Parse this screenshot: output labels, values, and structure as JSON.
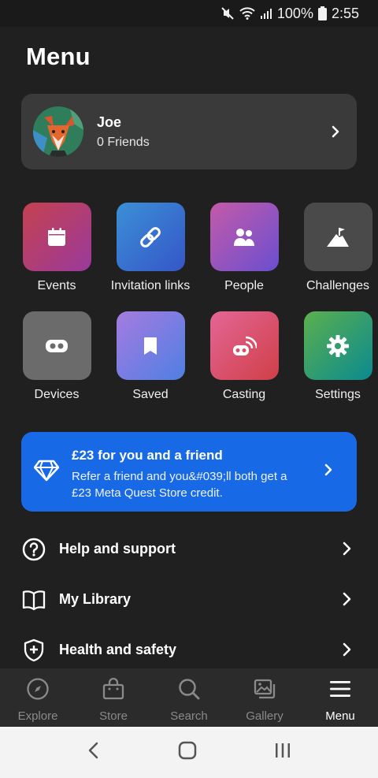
{
  "status_bar": {
    "battery": "100%",
    "time": "2:55",
    "icons": [
      "mute-icon",
      "wifi-icon",
      "signal-icon",
      "battery-icon"
    ]
  },
  "header": {
    "title": "Menu"
  },
  "profile": {
    "name": "Joe",
    "friends": "0 Friends"
  },
  "tiles": [
    {
      "label": "Events",
      "icon": "calendar-icon",
      "colors": [
        "#c5414f",
        "#9a3a9c"
      ]
    },
    {
      "label": "Invitation links",
      "icon": "link-icon",
      "colors": [
        "#3b8fd6",
        "#3556c8"
      ]
    },
    {
      "label": "People",
      "icon": "people-icon",
      "colors": [
        "#c45aa8",
        "#6a4fd0"
      ]
    },
    {
      "label": "Challenges",
      "icon": "mountain-flag-icon",
      "colors": [
        "#4a4a4a",
        "#4a4a4a"
      ]
    },
    {
      "label": "Devices",
      "icon": "vr-headset-icon",
      "colors": [
        "#6b6b6b",
        "#6b6b6b"
      ]
    },
    {
      "label": "Saved",
      "icon": "bookmark-icon",
      "colors": [
        "#a57be0",
        "#4f7fe3"
      ]
    },
    {
      "label": "Casting",
      "icon": "casting-icon",
      "colors": [
        "#e46696",
        "#cf3f47"
      ]
    },
    {
      "label": "Settings",
      "icon": "gear-icon",
      "colors": [
        "#5cb04e",
        "#0a8a8f"
      ]
    }
  ],
  "promo": {
    "title": "£23 for you and a friend",
    "body": "Refer a friend and you&#039;ll both get a £23 Meta Quest Store credit.",
    "icon": "diamond-icon",
    "color": "#1769e6"
  },
  "list": [
    {
      "label": "Help and support",
      "icon": "question-circle-icon"
    },
    {
      "label": "My Library",
      "icon": "book-icon"
    },
    {
      "label": "Health and safety",
      "icon": "shield-plus-icon"
    }
  ],
  "bottom_nav": [
    {
      "label": "Explore",
      "icon": "compass-icon",
      "active": false
    },
    {
      "label": "Store",
      "icon": "shopping-bag-icon",
      "active": false
    },
    {
      "label": "Search",
      "icon": "search-icon",
      "active": false
    },
    {
      "label": "Gallery",
      "icon": "gallery-icon",
      "active": false
    },
    {
      "label": "Menu",
      "icon": "hamburger-menu-icon",
      "active": true
    }
  ],
  "android_nav": [
    "back-icon",
    "home-icon",
    "recents-icon"
  ]
}
